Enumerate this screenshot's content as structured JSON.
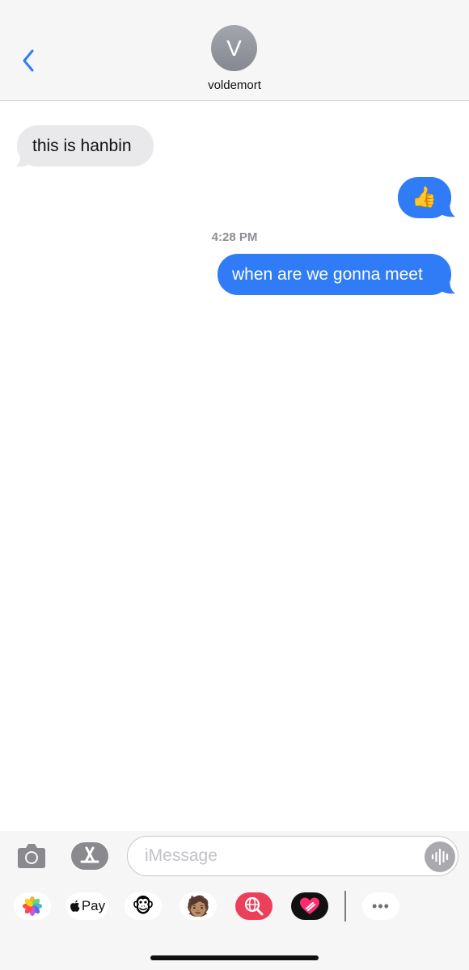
{
  "header": {
    "back_icon": "chevron-left-icon",
    "avatar_initial": "V",
    "contact_name": "voldemort"
  },
  "messages": [
    {
      "direction": "incoming",
      "text": "this is hanbin"
    },
    {
      "direction": "outgoing",
      "text": "👍"
    },
    {
      "direction": "outgoing",
      "text": "when are we gonna meet"
    }
  ],
  "timestamp": "4:28 PM",
  "input_bar": {
    "camera_icon": "camera-icon",
    "appstore_icon": "app-store-icon",
    "placeholder": "iMessage",
    "value": "",
    "audio_icon": "audio-waveform-icon"
  },
  "app_drawer": {
    "apps": [
      {
        "name": "photos",
        "icon": "photos-icon",
        "label": ""
      },
      {
        "name": "apple-pay",
        "icon": "apple-logo-icon",
        "label": "Pay"
      },
      {
        "name": "animoji",
        "icon": "monkey-icon",
        "label": "🐵"
      },
      {
        "name": "memoji-stickers",
        "icon": "memoji-icon",
        "label": "🧑🏽"
      },
      {
        "name": "images-search",
        "icon": "globe-search-icon",
        "label": ""
      },
      {
        "name": "digital-touch",
        "icon": "heart-touch-icon",
        "label": ""
      },
      {
        "name": "more",
        "icon": "more-icon",
        "label": "•••"
      }
    ]
  },
  "colors": {
    "accent": "#2f7cf6",
    "incoming_bubble": "#e9e9eb",
    "header_bg": "#f6f6f6"
  }
}
